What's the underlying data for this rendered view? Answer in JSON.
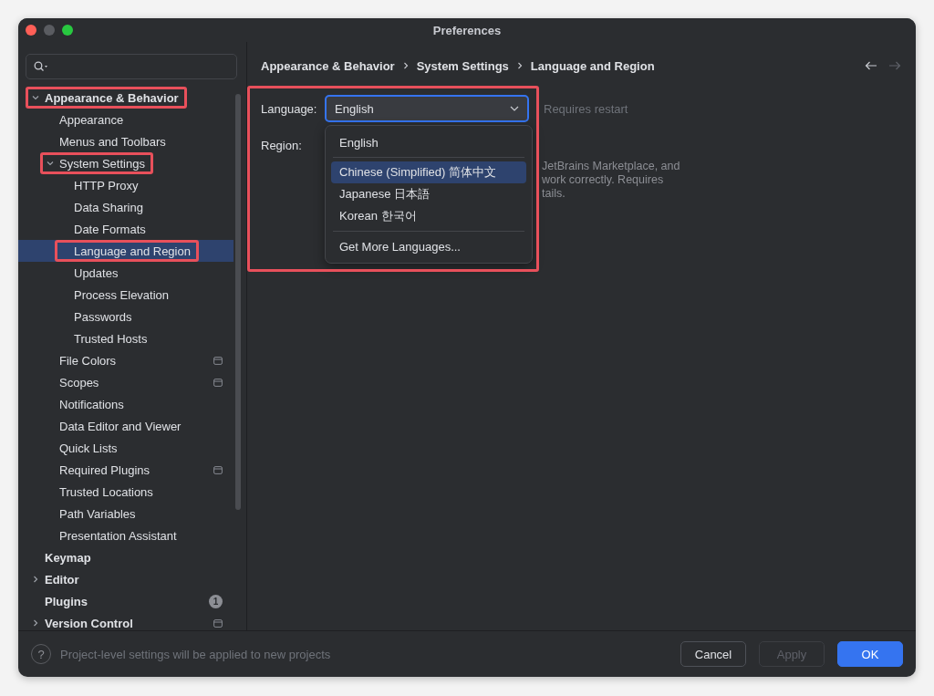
{
  "window": {
    "title": "Preferences"
  },
  "sidebar": {
    "items": [
      {
        "label": "Appearance & Behavior",
        "expanded": true,
        "selected": false,
        "highlighted": true,
        "children": [
          {
            "label": "Appearance",
            "selected": false,
            "highlighted": false
          },
          {
            "label": "Menus and Toolbars",
            "selected": false,
            "highlighted": false
          },
          {
            "label": "System Settings",
            "expanded": true,
            "selected": false,
            "highlighted": true,
            "children": [
              {
                "label": "HTTP Proxy",
                "selected": false,
                "highlighted": false
              },
              {
                "label": "Data Sharing",
                "selected": false,
                "highlighted": false
              },
              {
                "label": "Date Formats",
                "selected": false,
                "highlighted": false
              },
              {
                "label": "Language and Region",
                "selected": true,
                "highlighted": true
              },
              {
                "label": "Updates",
                "selected": false,
                "highlighted": false
              },
              {
                "label": "Process Elevation",
                "selected": false,
                "highlighted": false
              },
              {
                "label": "Passwords",
                "selected": false,
                "highlighted": false
              },
              {
                "label": "Trusted Hosts",
                "selected": false,
                "highlighted": false
              }
            ]
          },
          {
            "label": "File Colors",
            "selected": false,
            "highlighted": false,
            "project_level": true
          },
          {
            "label": "Scopes",
            "selected": false,
            "highlighted": false,
            "project_level": true
          },
          {
            "label": "Notifications",
            "selected": false,
            "highlighted": false
          },
          {
            "label": "Data Editor and Viewer",
            "selected": false,
            "highlighted": false
          },
          {
            "label": "Quick Lists",
            "selected": false,
            "highlighted": false
          },
          {
            "label": "Required Plugins",
            "selected": false,
            "highlighted": false,
            "project_level": true
          },
          {
            "label": "Trusted Locations",
            "selected": false,
            "highlighted": false
          },
          {
            "label": "Path Variables",
            "selected": false,
            "highlighted": false
          },
          {
            "label": "Presentation Assistant",
            "selected": false,
            "highlighted": false
          }
        ]
      },
      {
        "label": "Keymap",
        "selected": false,
        "highlighted": false
      },
      {
        "label": "Editor",
        "expanded": false,
        "selected": false,
        "highlighted": false
      },
      {
        "label": "Plugins",
        "selected": false,
        "highlighted": false,
        "badge": "1"
      },
      {
        "label": "Version Control",
        "expanded": false,
        "selected": false,
        "highlighted": false,
        "project_level": true
      }
    ]
  },
  "breadcrumb": [
    "Appearance & Behavior",
    "System Settings",
    "Language and Region"
  ],
  "settings": {
    "highlighted": true,
    "language": {
      "label": "Language:",
      "value": "English",
      "note": "Requires restart"
    },
    "region": {
      "label": "Region:"
    },
    "hint_lines": [
      "JetBrains Marketplace, and",
      "work correctly. Requires",
      "tails."
    ],
    "dropdown": {
      "groups": [
        [
          {
            "label": "English",
            "selected": false
          }
        ],
        [
          {
            "label": "Chinese (Simplified) 简体中文",
            "selected": true
          },
          {
            "label": "Japanese 日本語",
            "selected": false
          },
          {
            "label": "Korean 한국어",
            "selected": false
          }
        ],
        [
          {
            "label": "Get More Languages...",
            "selected": false
          }
        ]
      ]
    }
  },
  "footer": {
    "help": "?",
    "note": "Project-level settings will be applied to new projects",
    "buttons": [
      {
        "label": "Cancel",
        "kind": "normal",
        "disabled": false
      },
      {
        "label": "Apply",
        "kind": "normal",
        "disabled": true
      },
      {
        "label": "OK",
        "kind": "primary",
        "disabled": false
      }
    ]
  }
}
